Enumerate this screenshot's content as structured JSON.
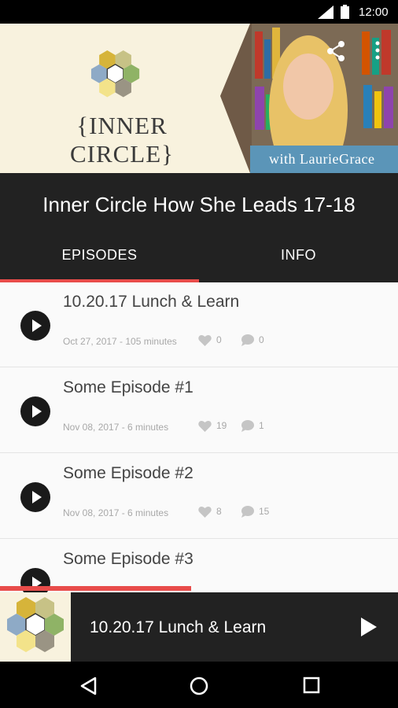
{
  "status_bar": {
    "time": "12:00"
  },
  "banner": {
    "brand": "{INNER CIRCLE}",
    "host": "with LaurieGrace"
  },
  "podcast_title": "Inner Circle How She Leads 17-18",
  "tabs": [
    "EPISODES",
    "INFO"
  ],
  "episodes": [
    {
      "title": "10.20.17 Lunch & Learn",
      "meta": "Oct 27, 2017 - 105 minutes",
      "likes": "0",
      "comments": "0"
    },
    {
      "title": "Some Episode #1",
      "meta": "Nov 08, 2017 - 6 minutes",
      "likes": "19",
      "comments": "1"
    },
    {
      "title": "Some Episode #2",
      "meta": "Nov 08, 2017 - 6 minutes",
      "likes": "8",
      "comments": "15"
    },
    {
      "title": "Some Episode #3",
      "meta": "",
      "likes": "",
      "comments": ""
    }
  ],
  "playback_progress": 0.48,
  "player": {
    "now_playing": "10.20.17 Lunch & Learn"
  },
  "colors": {
    "accent": "#e84c4a",
    "banner_bg": "#f8f2de",
    "host_tag": "#5b95b8",
    "bar_dark": "#222222"
  },
  "icons": [
    "signal-icon",
    "battery-icon",
    "share-icon",
    "more-vert-icon",
    "play-icon",
    "heart-icon",
    "comment-icon",
    "back-icon",
    "home-icon",
    "recents-icon"
  ]
}
